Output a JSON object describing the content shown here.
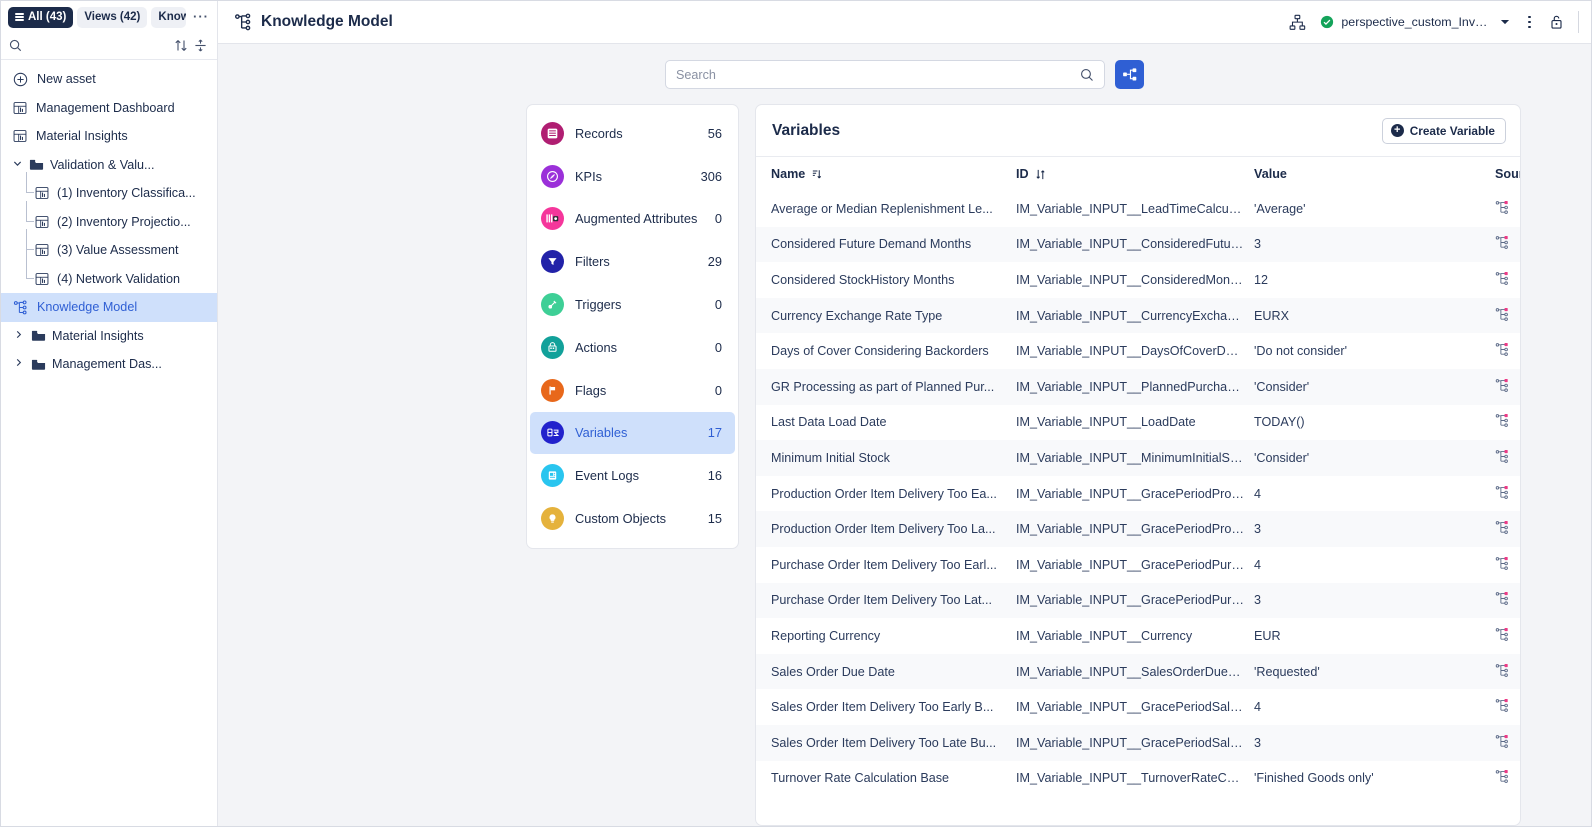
{
  "sidebar": {
    "tabs": [
      {
        "label": "All (43)",
        "active": true,
        "icon": "hamburger-icon"
      },
      {
        "label": "Views (42)",
        "active": false
      },
      {
        "label": "Knowledge",
        "active": false,
        "clipped": true
      }
    ],
    "more_label": "···",
    "search_placeholder": "",
    "items": [
      {
        "label": "New asset",
        "icon": "plus-circle-icon",
        "type": "action"
      },
      {
        "label": "Management Dashboard",
        "icon": "dashboard-icon",
        "type": "asset"
      },
      {
        "label": "Material Insights",
        "icon": "dashboard-icon",
        "type": "asset"
      },
      {
        "label": "Validation & Valu...",
        "icon": "folder-icon",
        "type": "folder-open",
        "caret": "∨"
      },
      {
        "label": "(1) Inventory Classifica...",
        "icon": "dashboard-icon",
        "type": "child"
      },
      {
        "label": "(2) Inventory Projectio...",
        "icon": "dashboard-icon",
        "type": "child"
      },
      {
        "label": "(3) Value Assessment",
        "icon": "dashboard-icon",
        "type": "child"
      },
      {
        "label": "(4) Network Validation",
        "icon": "dashboard-icon",
        "type": "child"
      },
      {
        "label": "Knowledge Model",
        "icon": "knowledge-model-icon",
        "type": "asset",
        "selected": true
      },
      {
        "label": "Material Insights",
        "icon": "folder-icon",
        "type": "folder",
        "caret": "›"
      },
      {
        "label": "Management Das...",
        "icon": "folder-icon",
        "type": "folder",
        "caret": "›"
      }
    ]
  },
  "topbar": {
    "title": "Knowledge Model",
    "title_icon": "knowledge-model-icon",
    "share_icon": "org-tree-icon",
    "perspective": "perspective_custom_Inven...",
    "perspective_status_icon": "check-circle-icon",
    "dropdown_icon": "chevron-down-icon",
    "menu_icon": "kebab-menu-icon",
    "lock_icon": "lock-icon"
  },
  "search": {
    "placeholder": "Search",
    "value": "",
    "icon": "search-icon",
    "action_button_icon": "reorder-nodes-icon"
  },
  "categories": [
    {
      "label": "Records",
      "count": "56",
      "color": "#b01e72",
      "icon": "records-icon"
    },
    {
      "label": "KPIs",
      "count": "306",
      "color": "#9b30d9",
      "icon": "kpi-gauge-icon"
    },
    {
      "label": "Augmented Attributes",
      "count": "0",
      "color": "#f5369b",
      "icon": "augmented-attributes-icon"
    },
    {
      "label": "Filters",
      "count": "29",
      "color": "#2222a8",
      "icon": "filter-funnel-icon"
    },
    {
      "label": "Triggers",
      "count": "0",
      "color": "#3ecf96",
      "icon": "trigger-icon"
    },
    {
      "label": "Actions",
      "count": "0",
      "color": "#12a19a",
      "icon": "action-icon"
    },
    {
      "label": "Flags",
      "count": "0",
      "color": "#e8681b",
      "icon": "flag-icon"
    },
    {
      "label": "Variables",
      "count": "17",
      "color": "#2222cc",
      "icon": "variables-icon",
      "active": true
    },
    {
      "label": "Event Logs",
      "count": "16",
      "color": "#29c5ef",
      "icon": "event-log-icon"
    },
    {
      "label": "Custom Objects",
      "count": "15",
      "color": "#e5b23c",
      "icon": "lightbulb-icon"
    }
  ],
  "table": {
    "title": "Variables",
    "create_label": "Create Variable",
    "columns": [
      {
        "label": "Name",
        "sort_icon": "sort-desc-icon"
      },
      {
        "label": "ID",
        "sort_icon": "sort-icon"
      },
      {
        "label": "Value",
        "sort_icon": ""
      },
      {
        "label": "Source",
        "sort_icon": "sort-icon"
      }
    ],
    "rows": [
      {
        "name": "Average or Median Replenishment Le...",
        "id": "IM_Variable_INPUT__LeadTimeCalculat...",
        "value": "'Average'",
        "source_icon": "knowledge-model-node-icon"
      },
      {
        "name": "Considered Future Demand Months",
        "id": "IM_Variable_INPUT__ConsideredFuture...",
        "value": "3",
        "source_icon": "knowledge-model-node-icon"
      },
      {
        "name": "Considered StockHistory Months",
        "id": "IM_Variable_INPUT__ConsideredMonths",
        "value": "12",
        "source_icon": "knowledge-model-node-icon"
      },
      {
        "name": "Currency Exchange Rate Type",
        "id": "IM_Variable_INPUT__CurrencyExchang...",
        "value": "EURX",
        "source_icon": "knowledge-model-node-icon"
      },
      {
        "name": "Days of Cover Considering Backorders",
        "id": "IM_Variable_INPUT__DaysOfCoverDue...",
        "value": "'Do not consider'",
        "source_icon": "knowledge-model-node-icon"
      },
      {
        "name": "GR Processing as part of Planned Pur...",
        "id": "IM_Variable_INPUT__PlannedPurchase...",
        "value": "'Consider'",
        "source_icon": "knowledge-model-node-icon"
      },
      {
        "name": "Last Data Load Date",
        "id": "IM_Variable_INPUT__LoadDate",
        "value": "TODAY()",
        "source_icon": "knowledge-model-node-icon"
      },
      {
        "name": "Minimum Initial Stock",
        "id": "IM_Variable_INPUT__MinimumInitialSto...",
        "value": "'Consider'",
        "source_icon": "knowledge-model-node-icon"
      },
      {
        "name": "Production Order Item Delivery Too Ea...",
        "id": "IM_Variable_INPUT__GracePeriodProd...",
        "value": "4",
        "source_icon": "knowledge-model-node-icon"
      },
      {
        "name": "Production Order Item Delivery Too La...",
        "id": "IM_Variable_INPUT__GracePeriodProd...",
        "value": "3",
        "source_icon": "knowledge-model-node-icon"
      },
      {
        "name": "Purchase Order Item Delivery Too Earl...",
        "id": "IM_Variable_INPUT__GracePeriodPurch...",
        "value": "4",
        "source_icon": "knowledge-model-node-icon"
      },
      {
        "name": "Purchase Order Item Delivery Too Lat...",
        "id": "IM_Variable_INPUT__GracePeriodPurch...",
        "value": "3",
        "source_icon": "knowledge-model-node-icon"
      },
      {
        "name": "Reporting Currency",
        "id": "IM_Variable_INPUT__Currency",
        "value": "EUR",
        "source_icon": "knowledge-model-node-icon"
      },
      {
        "name": "Sales Order Due Date",
        "id": "IM_Variable_INPUT__SalesOrderDueDate",
        "value": "'Requested'",
        "source_icon": "knowledge-model-node-icon"
      },
      {
        "name": "Sales Order Item Delivery Too Early B...",
        "id": "IM_Variable_INPUT__GracePeriodSales...",
        "value": "4",
        "source_icon": "knowledge-model-node-icon"
      },
      {
        "name": "Sales Order Item Delivery Too Late Bu...",
        "id": "IM_Variable_INPUT__GracePeriodSales...",
        "value": "3",
        "source_icon": "knowledge-model-node-icon"
      },
      {
        "name": "Turnover Rate Calculation Base",
        "id": "IM_Variable_INPUT__TurnoverRateCon...",
        "value": "'Finished Goods only'",
        "source_icon": "knowledge-model-node-icon"
      }
    ]
  },
  "colors": {
    "accent": "#2f5fd4",
    "navy": "#1c2b4a",
    "selected_bg": "#cfe0fb",
    "source_node": "#ec3b86"
  }
}
